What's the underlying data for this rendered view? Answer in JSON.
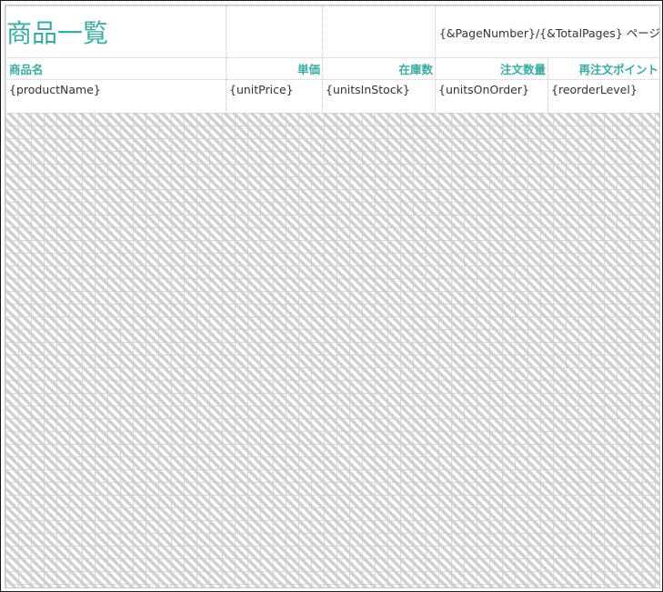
{
  "report": {
    "title": "商品一覧",
    "page_info": "{&PageNumber}/{&TotalPages} ページ",
    "columns": [
      {
        "header": "商品名",
        "field": "{productName}"
      },
      {
        "header": "単価",
        "field": "{unitPrice}"
      },
      {
        "header": "在庫数",
        "field": "{unitsInStock}"
      },
      {
        "header": "注文数量",
        "field": "{unitsOnOrder}"
      },
      {
        "header": "再注文ポイント",
        "field": "{reorderLevel}"
      }
    ]
  },
  "colors": {
    "accent": "#3aaaa3",
    "hatch": "#d0d0d0",
    "grid": "#c9c9c9"
  }
}
